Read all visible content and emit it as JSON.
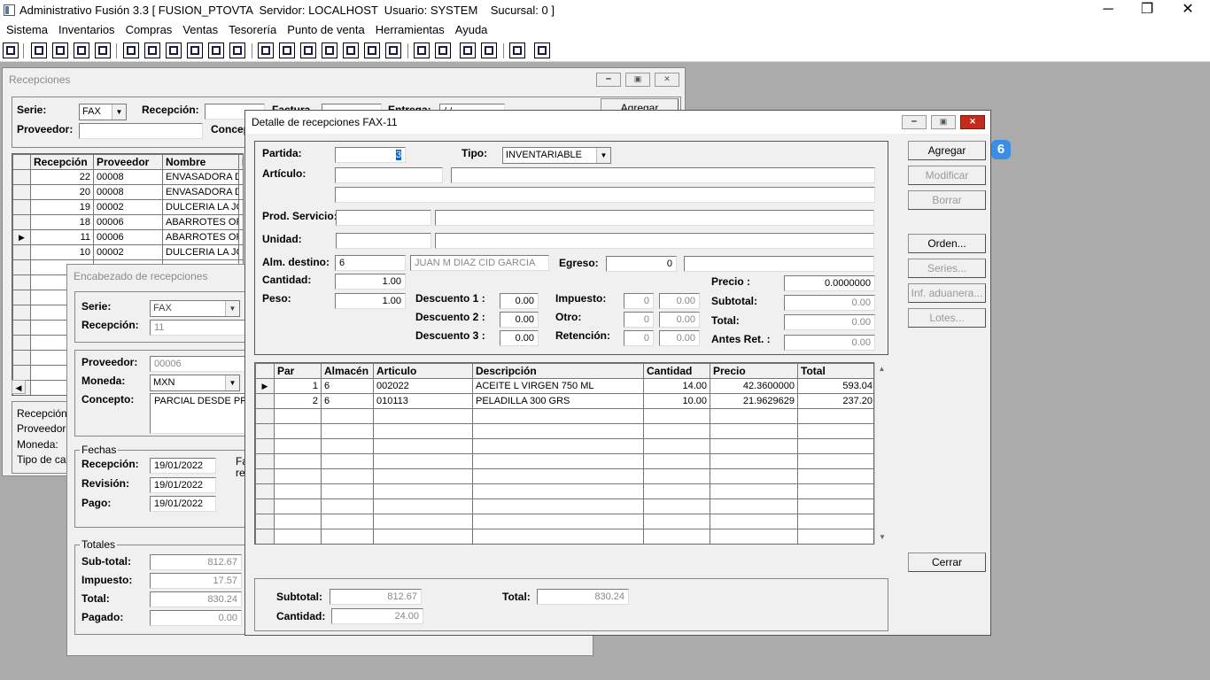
{
  "app": {
    "title": "Administrativo Fusión 3.3 [ FUSION_PTOVTA  Servidor: LOCALHOST  Usuario: SYSTEM    Sucursal: 0 ]",
    "minimize": "─",
    "maximize": "❐",
    "close": "✕"
  },
  "menu": [
    "Sistema",
    "Inventarios",
    "Compras",
    "Ventas",
    "Tesorería",
    "Punto de venta",
    "Herramientas",
    "Ayuda"
  ],
  "recepciones": {
    "title": "Recepciones",
    "serie_label": "Serie:",
    "serie_value": "FAX",
    "recepcion_label": "Recepción:",
    "factura_label": "Factura",
    "entrega_label": "Entrega:",
    "entrega_value": "/ /",
    "proveedor_label": "Proveedor:",
    "concepto_label": "Concep",
    "agregar": "Agregar",
    "columns": [
      "Recepción",
      "Proveedor",
      "Nombre",
      "F"
    ],
    "rows": [
      [
        "22",
        "00008",
        "ENVASADORA D"
      ],
      [
        "20",
        "00008",
        "ENVASADORA D"
      ],
      [
        "19",
        "00002",
        "DULCERIA LA JC"
      ],
      [
        "18",
        "00006",
        "ABARROTES OR"
      ],
      [
        "11",
        "00006",
        "ABARROTES OR"
      ],
      [
        "10",
        "00002",
        "DULCERIA LA JC"
      ]
    ],
    "bottom_labels": [
      "Recepción:",
      "Proveedor:",
      "Moneda:",
      "Tipo de cam"
    ]
  },
  "encabezado": {
    "title": "Encabezado de recepciones",
    "serie_label": "Serie:",
    "serie_value": "FAX",
    "recepcion_label": "Recepción:",
    "recepcion_value": "11",
    "proveedor_label": "Proveedor:",
    "proveedor_value": "00006",
    "moneda_label": "Moneda:",
    "moneda_value": "MXN",
    "concepto_label": "Concepto:",
    "concepto_value": "PARCIAL DESDE PRO",
    "fechas_label": "Fechas",
    "f_recepcion_label": "Recepción:",
    "f_recepcion": "19/01/2022",
    "f_revision_label": "Revisión:",
    "f_revision": "19/01/2022",
    "f_pago_label": "Pago:",
    "f_pago": "19/01/2022",
    "fa_text": "Fa",
    "re_text": "re",
    "totales_label": "Totales",
    "subtotal_label": "Sub-total:",
    "subtotal": "812.67",
    "impuesto_label": "Impuesto:",
    "impuesto": "17.57",
    "total_label": "Total:",
    "total": "830.24",
    "pagado_label": "Pagado:",
    "pagado": "0.00"
  },
  "detalle": {
    "title": "Detalle de recepciones FAX-11",
    "partida_label": "Partida:",
    "partida_value": "3",
    "tipo_label": "Tipo:",
    "tipo_value": "INVENTARIABLE",
    "articulo_label": "Artículo:",
    "prod_servicio_label": "Prod. Servicio:",
    "unidad_label": "Unidad:",
    "alm_destino_label": "Alm. destino:",
    "alm_destino_value": "6",
    "alm_destino_name": "JUAN M DIAZ CID GARCIA",
    "egreso_label": "Egreso:",
    "egreso_value": "0",
    "cantidad_label": "Cantidad:",
    "cantidad_value": "1.00",
    "peso_label": "Peso:",
    "peso_value": "1.00",
    "desc1_label": "Descuento 1 :",
    "desc1": "0.00",
    "desc2_label": "Descuento 2 :",
    "desc2": "0.00",
    "desc3_label": "Descuento 3 :",
    "desc3": "0.00",
    "impuesto_label": "Impuesto:",
    "impuesto_pct": "0",
    "impuesto_val": "0.00",
    "otro_label": "Otro:",
    "otro_pct": "0",
    "otro_val": "0.00",
    "retencion_label": "Retención:",
    "retencion_pct": "0",
    "retencion_val": "0.00",
    "precio_label": "Precio :",
    "precio": "0.0000000",
    "subtotal_label": "Subtotal:",
    "subtotal": "0.00",
    "total_label": "Total:",
    "total": "0.00",
    "antes_ret_label": "Antes Ret. :",
    "antes_ret": "0.00",
    "buttons": {
      "agregar": "Agregar",
      "modificar": "Modificar",
      "borrar": "Borrar",
      "orden": "Orden...",
      "series": "Series...",
      "inf_aduanera": "Inf. aduanera...",
      "lotes": "Lotes...",
      "cerrar": "Cerrar"
    },
    "grid_columns": [
      "Par",
      "Almacén",
      "Articulo",
      "Descripción",
      "Cantidad",
      "Precio",
      "Total"
    ],
    "grid_rows": [
      [
        "1",
        "6",
        "002022",
        "ACEITE L VIRGEN 750 ML",
        "14.00",
        "42.3600000",
        "593.04"
      ],
      [
        "2",
        "6",
        "010113",
        "PELADILLA 300 GRS",
        "10.00",
        "21.9629629",
        "237.20"
      ]
    ],
    "foot_subtotal_label": "Subtotal:",
    "foot_subtotal": "812.67",
    "foot_total_label": "Total:",
    "foot_total": "830.24",
    "foot_cantidad_label": "Cantidad:",
    "foot_cantidad": "24.00"
  },
  "badge": "6"
}
